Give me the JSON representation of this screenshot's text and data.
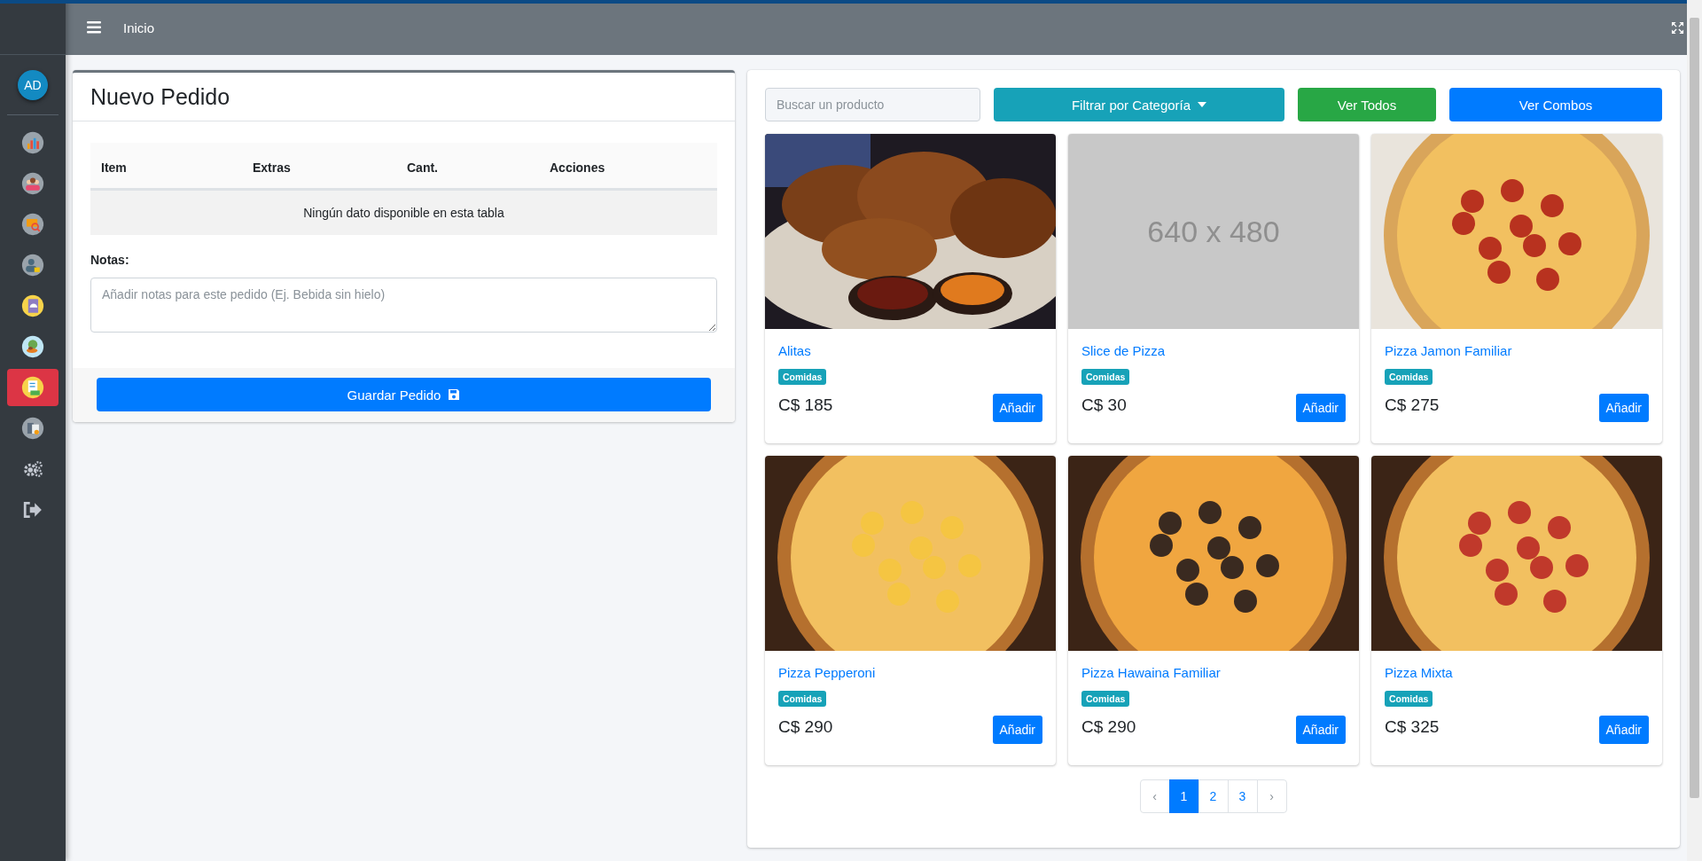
{
  "topbar": {
    "breadcrumb": "Inicio"
  },
  "sidebar": {
    "avatar": "AD",
    "items": [
      {
        "selected": false
      },
      {
        "selected": false
      },
      {
        "selected": false
      },
      {
        "selected": false
      },
      {
        "selected": false
      },
      {
        "selected": false
      },
      {
        "selected": true
      },
      {
        "selected": false
      },
      {
        "selected": false
      },
      {
        "selected": false
      }
    ]
  },
  "order": {
    "title": "Nuevo Pedido",
    "table": {
      "columns": [
        "Item",
        "Extras",
        "Cant.",
        "Acciones"
      ],
      "empty_message": "Ningún dato disponible en esta tabla"
    },
    "notes": {
      "label": "Notas:",
      "placeholder": "Añadir notas para este pedido (Ej. Bebida sin hielo)"
    },
    "save_button": "Guardar Pedido"
  },
  "catalog": {
    "search": {
      "placeholder": "Buscar un producto"
    },
    "filter_button": "Filtrar por Categoría",
    "buttons": [
      {
        "label": "Ver Todos",
        "kind": "success"
      },
      {
        "label": "Ver Combos",
        "kind": "primary"
      }
    ],
    "products": [
      {
        "name": "Alitas",
        "category": "Comidas",
        "price": "C$ 185",
        "button": "Añadir"
      },
      {
        "name": "Slice de Pizza",
        "category": "Comidas",
        "price": "C$ 30",
        "button": "Añadir",
        "image": {
          "kind": "placeholder",
          "label": "640 x 480"
        }
      },
      {
        "name": "Pizza Jamon Familiar",
        "category": "Comidas",
        "price": "C$ 275",
        "button": "Añadir"
      },
      {
        "name": "Pizza Pepperoni",
        "category": "Comidas",
        "price": "C$ 290",
        "button": "Añadir"
      },
      {
        "name": "Pizza Hawaina Familiar",
        "category": "Comidas",
        "price": "C$ 290",
        "button": "Añadir"
      },
      {
        "name": "Pizza Mixta",
        "category": "Comidas",
        "price": "C$ 325",
        "button": "Añadir"
      }
    ],
    "pagination": {
      "prev": "‹",
      "pages": [
        {
          "label": "1",
          "selected": true
        },
        {
          "label": "2",
          "selected": false
        },
        {
          "label": "3",
          "selected": false
        }
      ],
      "next": "›"
    }
  }
}
